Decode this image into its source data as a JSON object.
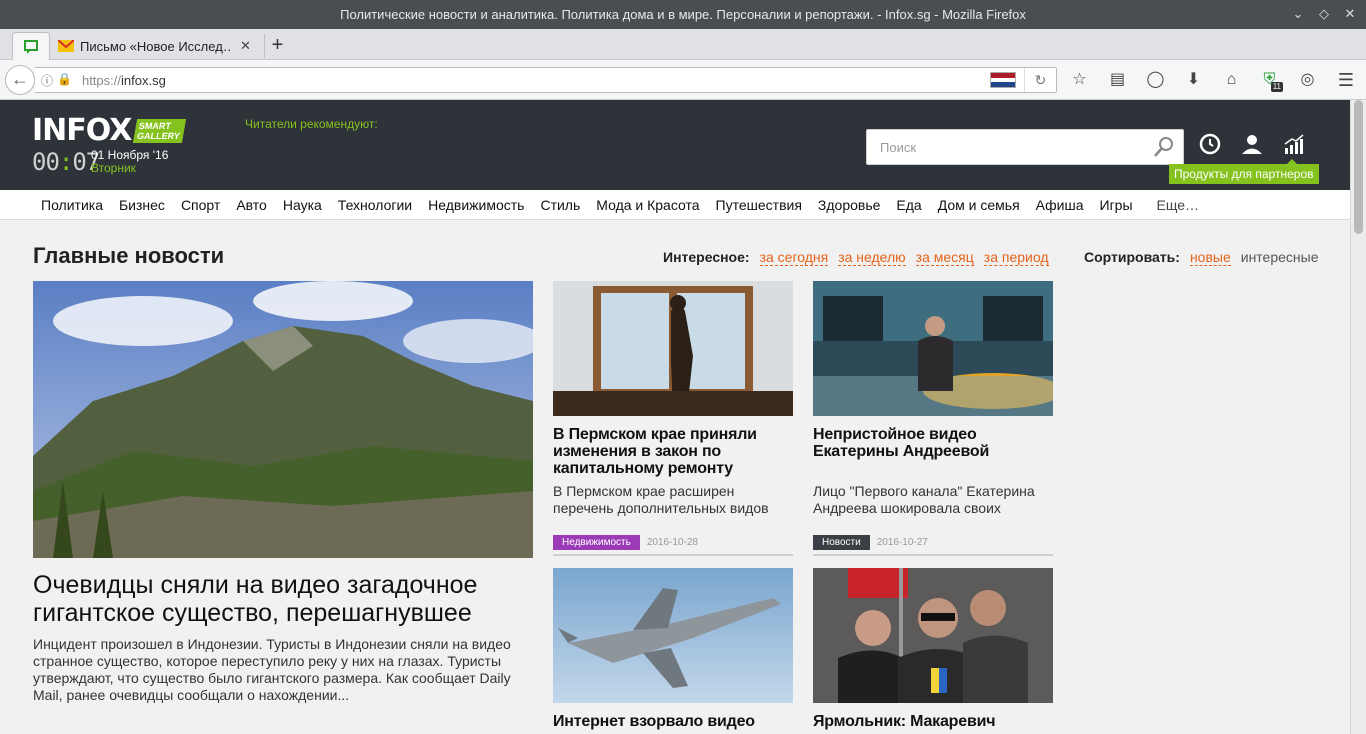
{
  "window": {
    "title": "Политические новости и аналитика. Политика дома и в мире. Персоналии и репортажи. - Infox.sg - Mozilla Firefox"
  },
  "tabs": [
    {
      "title": "Письмо «Новое Исслед…"
    }
  ],
  "address_bar": {
    "protocol": "https://",
    "host": "infox.sg"
  },
  "site": {
    "logo_text": "INFOX",
    "logo_badge_1": "SMART",
    "logo_badge_2": "GALLERY",
    "clock_hours": "00",
    "clock_separator": ":",
    "clock_minutes": "07",
    "date": "01 Ноября '16",
    "weekday": "Вторник",
    "recommend_label": "Читатели рекомендуют:",
    "search_placeholder": "Поиск",
    "partner_tooltip": "Продукты для партнеров"
  },
  "categories": [
    "Политика",
    "Бизнес",
    "Спорт",
    "Авто",
    "Наука",
    "Технологии",
    "Недвижимость",
    "Стиль",
    "Мода и Красота",
    "Путешествия",
    "Здоровье",
    "Еда",
    "Дом и семья",
    "Афиша",
    "Игры"
  ],
  "categories_more": "Еще…",
  "content": {
    "section_title": "Главные новости",
    "interesting_label": "Интересное:",
    "interesting_options": [
      "за сегодня",
      "за неделю",
      "за месяц",
      "за период"
    ],
    "sort_label": "Сортировать:",
    "sort_active": "новые",
    "sort_other": "интересные",
    "main_story": {
      "headline": "Очевидцы сняли на видео загадочное гигантское существо, перешагнувшее",
      "lede": "Инцидент произошел в Индонезии. Туристы в Индонезии сняли на видео странное существо, которое переступило реку у них на глазах. Туристы утверждают, что существо было гигантского размера. Как сообщает Daily Mail, ранее очевидцы сообщали о нахождении..."
    },
    "cards": [
      {
        "title": "В Пермском крае приняли изменения в закон по капитальному ремонту",
        "desc": "В Пермском крае расширен перечень дополнительных видов",
        "tag": "Недвижимость",
        "date": "2016-10-28"
      },
      {
        "title": "Непристойное видео Екатерины Андреевой",
        "desc": "Лицо \"Первого канала\" Екатерина Андреева шокировала своих",
        "tag": "Новости",
        "date": "2016-10-27"
      },
      {
        "title": "Интернет взорвало видео"
      },
      {
        "title": "Ярмольник: Макаревич"
      }
    ]
  },
  "colors": {
    "accent_green": "#86c21e",
    "accent_orange": "#e5631a",
    "header_bg": "#2e3239",
    "tag_purple": "#9c3bb8",
    "tag_dark": "#3b3f45"
  }
}
